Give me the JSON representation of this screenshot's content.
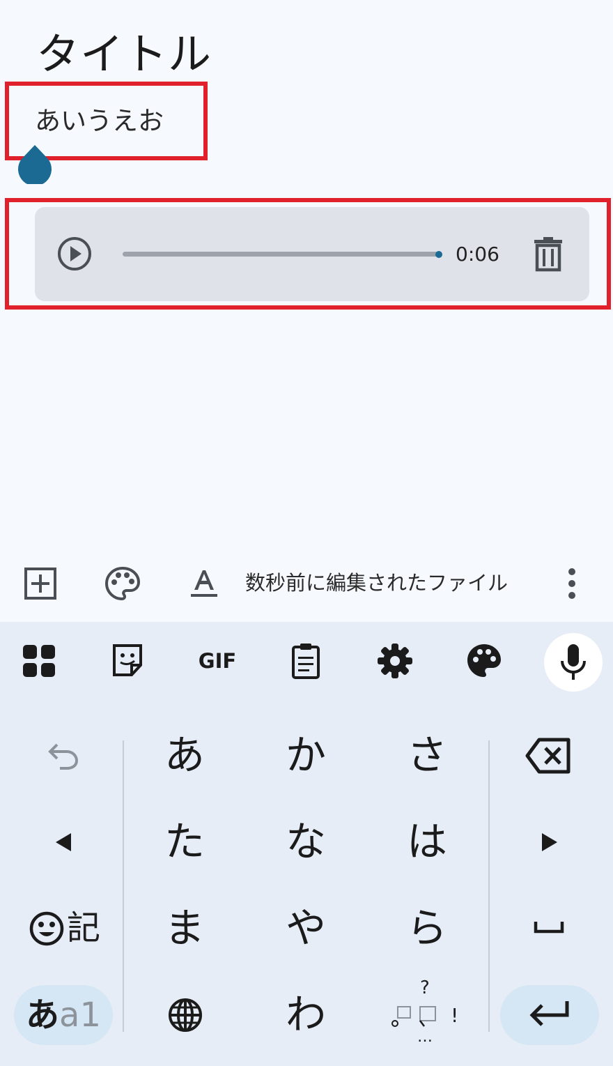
{
  "note": {
    "title": "タイトル",
    "body": "あいうえお"
  },
  "audio": {
    "duration": "0:06",
    "progress": 1.0
  },
  "toolbar": {
    "edited_status": "数秒前に編集されたファイル",
    "icons": [
      "add-box-icon",
      "palette-icon",
      "text-format-icon",
      "more-vert-icon"
    ]
  },
  "keyboard": {
    "top_icons": [
      "apps-grid-icon",
      "sticker-icon",
      "gif-icon",
      "clipboard-icon",
      "settings-icon",
      "theme-palette-icon",
      "microphone-icon"
    ],
    "gif_label": "GIF",
    "keys": {
      "a": "あ",
      "ka": "か",
      "sa": "さ",
      "ta": "た",
      "na": "な",
      "ha": "は",
      "ma": "ま",
      "ya": "や",
      "ra": "ら",
      "wa": "わ",
      "symbol_label": "記",
      "mode_primary": "あ",
      "mode_secondary": "a1",
      "punct_top": "?",
      "punct_right": "!",
      "punct_bottom": "…"
    }
  },
  "colors": {
    "accent": "#1a6a94",
    "highlight": "#e0212b",
    "card": "#dfe3e9",
    "keyboard_bg": "#e6edf6",
    "page_bg": "#f6f9fd"
  }
}
